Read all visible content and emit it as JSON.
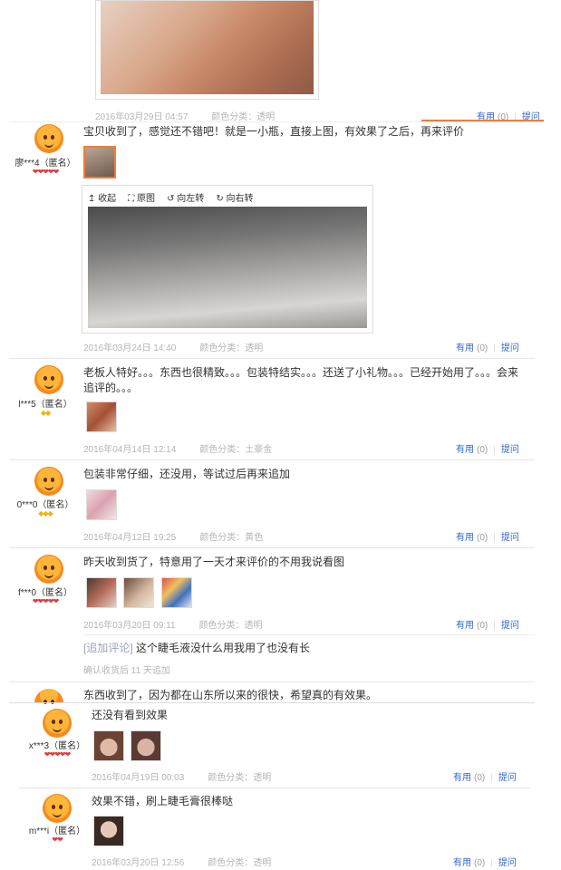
{
  "tools": {
    "collapse": "收起",
    "original": "原图",
    "rotate_left": "向左转",
    "rotate_right": "向右转"
  },
  "reviews": [
    {
      "meta": {
        "date": "2016年03月29日 04:57",
        "label": "颜色分类：透明"
      },
      "useful": "有用",
      "count": "(0)",
      "question": "提问"
    },
    {
      "user": "廖***4（匿名）",
      "gems": "❤❤❤❤❤",
      "text": "宝贝收到了，感觉还不错吧！就是一小瓶，直接上图，有效果了之后，再来评价",
      "meta": {
        "date": "2016年03月24日 14:40",
        "label": "颜色分类：透明"
      },
      "useful": "有用",
      "count": "(0)",
      "question": "提问"
    },
    {
      "user": "l***5（匿名）",
      "gems": "◆◆",
      "text1": "老板人特好。。。东西也很精致。。。包装特结实。。。还送了小礼物。。。已经开始用了。。。会来",
      "text2": "追评的。。。",
      "meta": {
        "date": "2016年04月14日 12:14",
        "label": "颜色分类：土豪金"
      },
      "useful": "有用",
      "count": "(0)",
      "question": "提问"
    },
    {
      "user": "0***0（匿名）",
      "gems": "◆◆◆",
      "text": "包装非常仔细，还没用，等试过后再来追加",
      "meta": {
        "date": "2016年04月12日 19:25",
        "label": "颜色分类：黄色"
      },
      "useful": "有用",
      "count": "(0)",
      "question": "提问"
    },
    {
      "user": "f***0（匿名）",
      "gems": "❤❤❤❤❤",
      "text": "昨天收到货了，特意用了一天才来评价的不用我说看图",
      "meta": {
        "date": "2016年03月20日 09:11",
        "label": "颜色分类：透明"
      },
      "useful": "有用",
      "count": "(0)",
      "question": "提问",
      "append_tag": "[追加评论]",
      "append_text": "这个睫毛液没什么用我用了也没有长",
      "append_meta": "确认收货后 11 天追加"
    },
    {
      "text": "东西收到了，因为都在山东所以来的很快，希望真的有效果。"
    },
    {
      "user": "x***3（匿名）",
      "gems": "❤❤❤❤❤",
      "text": "还没有看到效果",
      "meta": {
        "date": "2016年04月19日 00:03",
        "label": "颜色分类：透明"
      },
      "useful": "有用",
      "count": "(0)",
      "question": "提问"
    },
    {
      "user": "m***i（匿名）",
      "gems": "❤❤",
      "text": "效果不错，刷上睫毛膏很棒哒",
      "meta": {
        "date": "2016年03月20日 12:56",
        "label": "颜色分类：透明"
      },
      "useful": "有用",
      "count": "(0)",
      "question": "提问"
    }
  ]
}
